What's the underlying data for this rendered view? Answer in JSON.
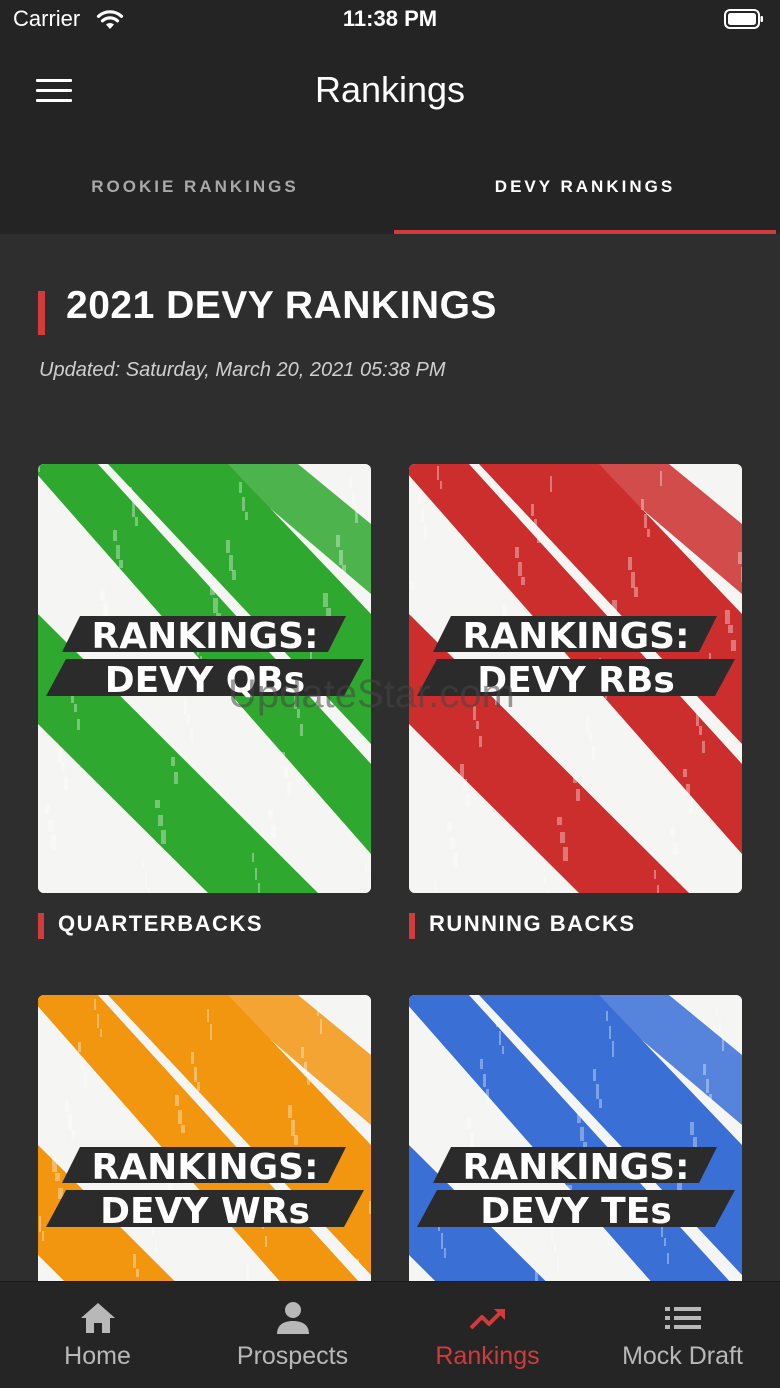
{
  "status": {
    "carrier": "Carrier",
    "time": "11:38 PM"
  },
  "header": {
    "title": "Rankings"
  },
  "tabs": [
    {
      "label": "ROOKIE RANKINGS",
      "active": false
    },
    {
      "label": "DEVY RANKINGS",
      "active": true
    }
  ],
  "page": {
    "title": "2021 DEVY RANKINGS",
    "updated": "Updated: Saturday, March 20, 2021 05:38 PM"
  },
  "cards": [
    {
      "label": "QUARTERBACKS",
      "image_line1": "RANKINGS:",
      "image_line2": "DEVY QBs",
      "color": "#2fa82f"
    },
    {
      "label": "RUNNING BACKS",
      "image_line1": "RANKINGS:",
      "image_line2": "DEVY RBs",
      "color": "#cc2e2e"
    },
    {
      "label": "",
      "image_line1": "RANKINGS:",
      "image_line2": "DEVY WRs",
      "color": "#f2950f"
    },
    {
      "label": "",
      "image_line1": "RANKINGS:",
      "image_line2": "DEVY TEs",
      "color": "#3a6fd6"
    }
  ],
  "watermark": "UpdateStar.com",
  "nav": [
    {
      "label": "Home",
      "icon": "home-icon",
      "active": false
    },
    {
      "label": "Prospects",
      "icon": "person-icon",
      "active": false
    },
    {
      "label": "Rankings",
      "icon": "trending-up-icon",
      "active": true
    },
    {
      "label": "Mock Draft",
      "icon": "list-icon",
      "active": false
    }
  ],
  "colors": {
    "accent": "#d13b3b",
    "header_bg": "#242424",
    "page_bg": "#2e2e2f"
  }
}
